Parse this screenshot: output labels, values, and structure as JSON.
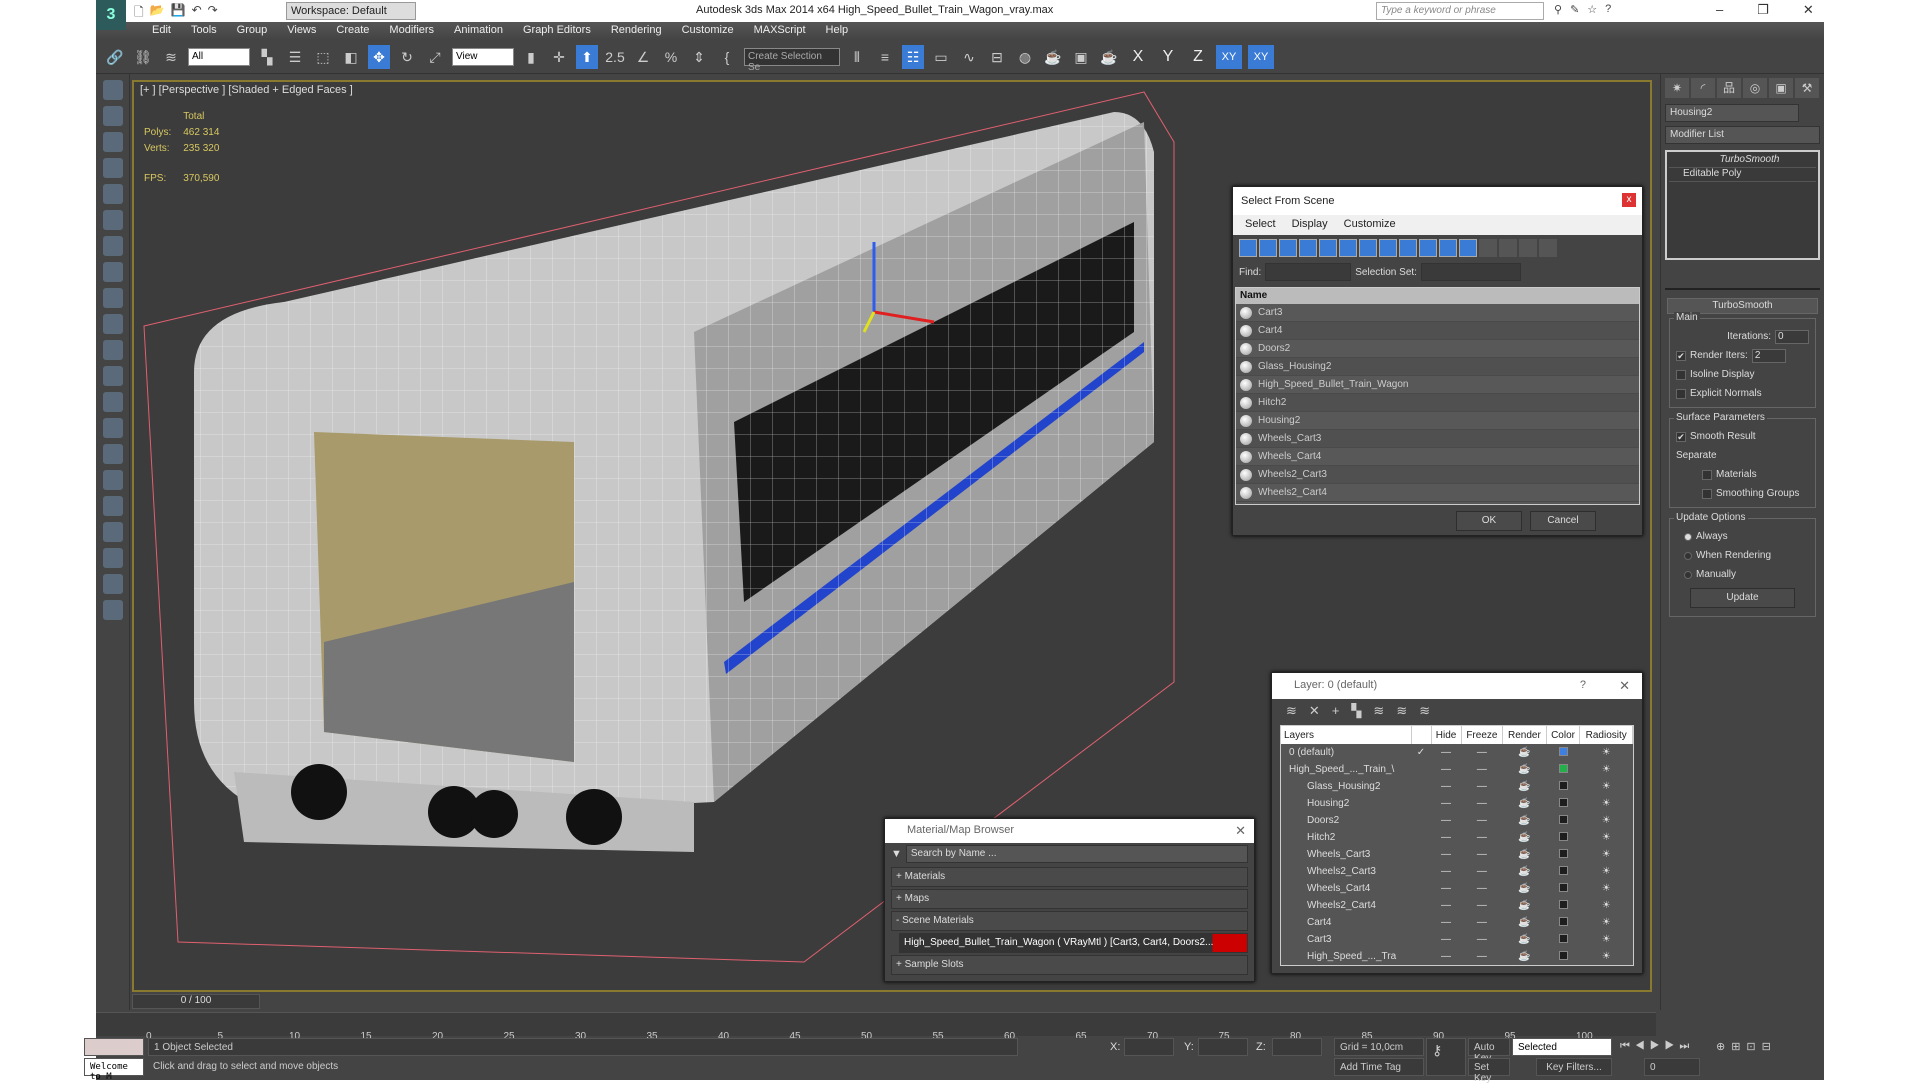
{
  "titlebar": {
    "workspace": "Workspace: Default",
    "title": "Autodesk 3ds Max  2014 x64     High_Speed_Bullet_Train_Wagon_vray.max",
    "search_placeholder": "Type a keyword or phrase",
    "minimize": "–",
    "maximize": "❐",
    "close": "✕"
  },
  "menu": [
    "Edit",
    "Tools",
    "Group",
    "Views",
    "Create",
    "Modifiers",
    "Animation",
    "Graph Editors",
    "Rendering",
    "Customize",
    "MAXScript",
    "Help"
  ],
  "toolbar": {
    "filter": "All",
    "refcoord": "View",
    "snap_angle": "2.5",
    "named_selection": "Create Selection Se",
    "axes": [
      "X",
      "Y",
      "Z",
      "XY",
      "XY"
    ]
  },
  "viewport": {
    "label": "[+ ] [Perspective ] [Shaded + Edged Faces ]",
    "stats": {
      "header": "Total",
      "polys_label": "Polys:",
      "polys": "462 314",
      "verts_label": "Verts:",
      "verts": "235 320",
      "fps_label": "FPS:",
      "fps": "370,590"
    }
  },
  "command_panel": {
    "object_name": "Housing2",
    "modifier_list": "Modifier List",
    "stack": [
      "TurboSmooth",
      "Editable Poly"
    ],
    "rollout": "TurboSmooth",
    "main": "Main",
    "iterations_label": "Iterations:",
    "iterations": "0",
    "render_iters_label": "Render Iters:",
    "render_iters": "2",
    "isoline": "Isoline Display",
    "explicit_normals": "Explicit Normals",
    "surface": "Surface Parameters",
    "smooth_result": "Smooth Result",
    "separate": "Separate",
    "materials": "Materials",
    "smoothing_groups": "Smoothing Groups",
    "update_options": "Update Options",
    "always": "Always",
    "when_rendering": "When Rendering",
    "manually": "Manually",
    "update": "Update"
  },
  "select_dialog": {
    "title": "Select From Scene",
    "close": "x",
    "menu": [
      "Select",
      "Display",
      "Customize"
    ],
    "find_label": "Find:",
    "selset_label": "Selection Set:",
    "col_name": "Name",
    "items": [
      "Cart3",
      "Cart4",
      "Doors2",
      "Glass_Housing2",
      "High_Speed_Bullet_Train_Wagon",
      "Hitch2",
      "Housing2",
      "Wheels_Cart3",
      "Wheels_Cart4",
      "Wheels2_Cart3",
      "Wheels2_Cart4"
    ],
    "ok": "OK",
    "cancel": "Cancel"
  },
  "layer_dialog": {
    "title": "Layer: 0 (default)",
    "help": "?",
    "close": "✕",
    "cols": [
      "Layers",
      "Hide",
      "Freeze",
      "Render",
      "Color",
      "Radiosity"
    ],
    "rows": [
      {
        "name": "0 (default)",
        "color": "#3f7fe0"
      },
      {
        "name": "High_Speed_..._Train_\\",
        "color": "#22b04a"
      },
      {
        "name": "Glass_Housing2",
        "color": "#1e1e1e"
      },
      {
        "name": "Housing2",
        "color": "#1e1e1e"
      },
      {
        "name": "Doors2",
        "color": "#1e1e1e"
      },
      {
        "name": "Hitch2",
        "color": "#1e1e1e"
      },
      {
        "name": "Wheels_Cart3",
        "color": "#1e1e1e"
      },
      {
        "name": "Wheels2_Cart3",
        "color": "#1e1e1e"
      },
      {
        "name": "Wheels_Cart4",
        "color": "#1e1e1e"
      },
      {
        "name": "Wheels2_Cart4",
        "color": "#1e1e1e"
      },
      {
        "name": "Cart4",
        "color": "#1e1e1e"
      },
      {
        "name": "Cart3",
        "color": "#1e1e1e"
      },
      {
        "name": "High_Speed_..._Tra",
        "color": "#1e1e1e"
      }
    ]
  },
  "material_browser": {
    "title": "Material/Map Browser",
    "search_placeholder": "Search by Name ...",
    "sections": [
      "+ Materials",
      "+ Maps",
      "- Scene Materials"
    ],
    "scene_material": "High_Speed_Bullet_Train_Wagon  ( VRayMtl ) [Cart3, Cart4, Doors2...",
    "sample_slots": "+ Sample Slots"
  },
  "timeline": {
    "frame": "0 / 100",
    "ticks": [
      "0",
      "5",
      "10",
      "15",
      "20",
      "25",
      "30",
      "35",
      "40",
      "45",
      "50",
      "55",
      "60",
      "65",
      "70",
      "75",
      "80",
      "85",
      "90",
      "95",
      "100"
    ]
  },
  "status": {
    "listener": "Welcome to M",
    "selected": "1 Object Selected",
    "prompt": "Click and drag to select and move objects",
    "x_label": "X:",
    "y_label": "Y:",
    "z_label": "Z:",
    "grid": "Grid = 10,0cm",
    "add_time_tag": "Add Time Tag",
    "auto_key": "Auto Key",
    "set_key": "Set Key",
    "key_mode": "Selected",
    "key_filters": "Key Filters...",
    "current_frame": "0"
  }
}
